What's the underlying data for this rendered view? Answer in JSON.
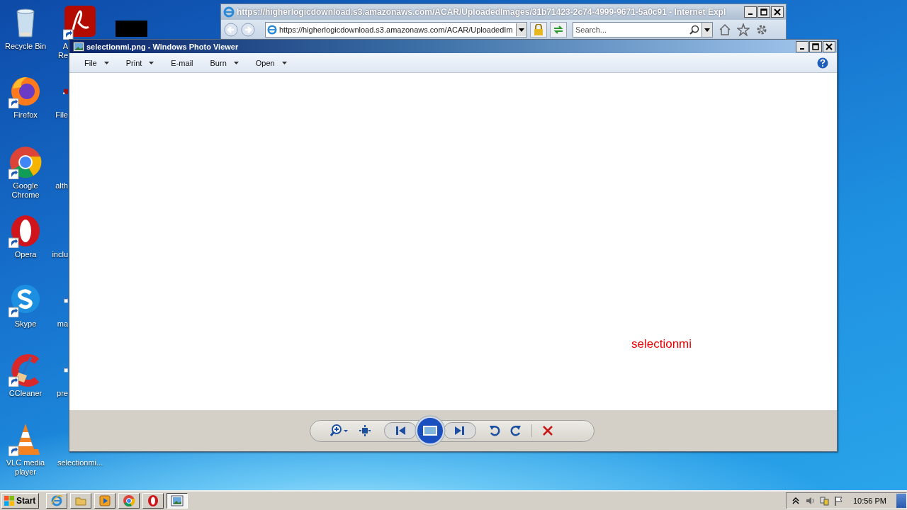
{
  "desktop_icons": [
    {
      "kind": "recycle",
      "lines": [
        "Recycle Bin"
      ]
    },
    {
      "kind": "acrobat",
      "lines": [
        "A",
        "Re"
      ]
    },
    {
      "kind": "black"
    },
    {
      "kind": "firefox",
      "lines": [
        "Firefox"
      ]
    },
    {
      "kind": "redfile",
      "lines": [
        "File"
      ]
    },
    {
      "kind": "chrome",
      "lines": [
        "Google",
        "Chrome"
      ]
    },
    {
      "kind": "blank",
      "lines": [
        "alth"
      ]
    },
    {
      "kind": "opera",
      "lines": [
        "Opera"
      ]
    },
    {
      "kind": "blank",
      "lines": [
        "inclu"
      ]
    },
    {
      "kind": "skype",
      "lines": [
        "Skype"
      ]
    },
    {
      "kind": "doc",
      "lines": [
        "ma"
      ]
    },
    {
      "kind": "ccleaner",
      "lines": [
        "CCleaner"
      ]
    },
    {
      "kind": "doc",
      "lines": [
        "pre"
      ]
    },
    {
      "kind": "vlc",
      "lines": [
        "VLC media",
        "player"
      ]
    },
    {
      "kind": "blank",
      "lines": [
        "selectionmi..."
      ]
    }
  ],
  "ie_window": {
    "title": "https://higherlogicdownload.s3.amazonaws.com/ACAR/UploadedImages/31b71423-2c74-4999-9671-5a0c91 - Internet Expl",
    "address": "https://higherlogicdownload.s3.amazonaws.com/ACAR/UploadedIm",
    "search_placeholder": "Search..."
  },
  "photo_viewer": {
    "title": "selectionmi.png - Windows Photo Viewer",
    "menu": [
      {
        "label": "File",
        "dropdown": true
      },
      {
        "label": "Print",
        "dropdown": true
      },
      {
        "label": "E-mail",
        "dropdown": false
      },
      {
        "label": "Burn",
        "dropdown": true
      },
      {
        "label": "Open",
        "dropdown": true
      }
    ],
    "image_text": "selectionmi"
  },
  "taskbar": {
    "start": "Start",
    "items": [
      {
        "kind": "ie",
        "selected": false
      },
      {
        "kind": "explorer",
        "selected": false
      },
      {
        "kind": "media",
        "selected": false
      },
      {
        "kind": "chrome",
        "selected": false
      },
      {
        "kind": "opera",
        "selected": false
      },
      {
        "kind": "photo",
        "selected": true
      }
    ],
    "time": "10:56 PM"
  }
}
